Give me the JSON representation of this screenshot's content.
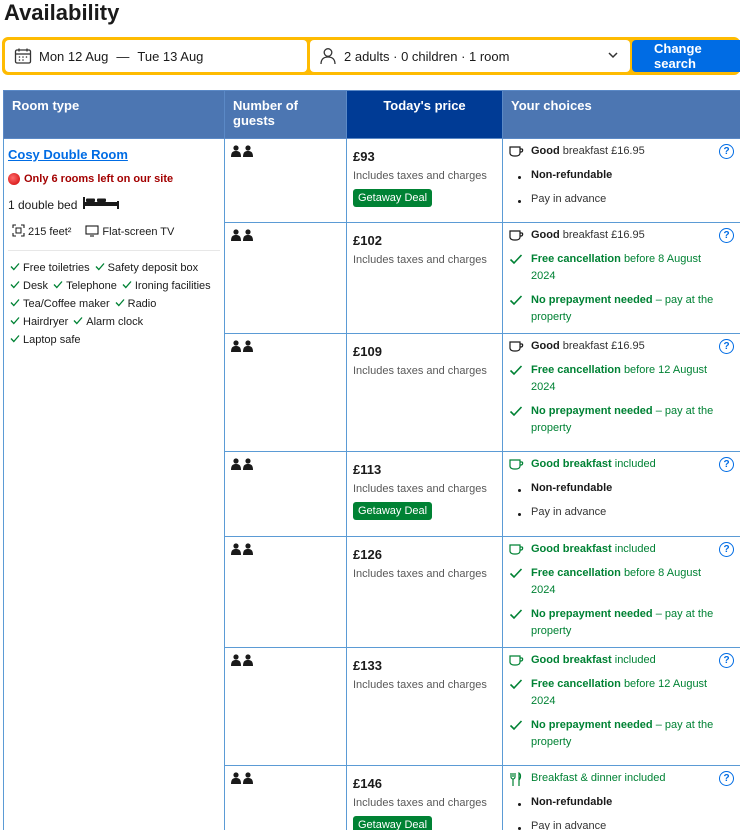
{
  "title": "Availability",
  "search": {
    "dates": {
      "checkin": "Mon 12 Aug",
      "separator": "—",
      "checkout": "Tue 13 Aug"
    },
    "guests": "2 adults · 0 children · 1 room",
    "button": "Change search"
  },
  "table": {
    "headers": {
      "room_type": "Room type",
      "guests": "Number of guests",
      "price": "Today's price",
      "choices": "Your choices"
    }
  },
  "room": {
    "name": "Cosy Double Room",
    "scarcity": "Only 6 rooms left on our site",
    "bed": "1 double bed",
    "size": "215 feet²",
    "tv": "Flat-screen TV",
    "amenities": [
      "Free toiletries",
      "Safety deposit box",
      "Desk",
      "Telephone",
      "Ironing facilities",
      "Tea/Coffee maker",
      "Radio",
      "Hairdryer",
      "Alarm clock",
      "Laptop safe"
    ]
  },
  "common": {
    "taxes": "Includes taxes and charges",
    "deal": "Getaway Deal",
    "breakfast_good": "Good",
    "breakfast_suffix": "breakfast £16.95",
    "good_breakfast": "Good breakfast",
    "included": "included",
    "non_refundable": "Non-refundable",
    "pay_in_advance": "Pay in advance",
    "free_cancellation": "Free cancellation",
    "no_prepayment": "No prepayment needed",
    "pay_at_property": "– pay at the property",
    "info": "?"
  },
  "rows": [
    {
      "price": "£93",
      "deal": true,
      "breakfast": "paid",
      "policy": "nonref"
    },
    {
      "price": "£102",
      "deal": false,
      "breakfast": "paid",
      "policy": "free",
      "cancel_before": "before 8 August 2024"
    },
    {
      "price": "£109",
      "deal": false,
      "breakfast": "paid",
      "policy": "free",
      "cancel_before": "before 12 August 2024"
    },
    {
      "price": "£113",
      "deal": true,
      "breakfast": "included",
      "policy": "nonref"
    },
    {
      "price": "£126",
      "deal": false,
      "breakfast": "included",
      "policy": "free",
      "cancel_before": "before 8 August 2024"
    },
    {
      "price": "£133",
      "deal": false,
      "breakfast": "included",
      "policy": "free",
      "cancel_before": "before 12 August 2024"
    },
    {
      "price": "£146",
      "deal": true,
      "breakfast": "dinner",
      "breakfast_dinner": "Breakfast & dinner included",
      "policy": "nonref"
    }
  ],
  "colors": {
    "accent": "#006ce4",
    "header": "#4c76b2",
    "header_price": "#003b95",
    "search_border": "#febb02",
    "green": "#008234",
    "scarcity": "#a30000"
  }
}
